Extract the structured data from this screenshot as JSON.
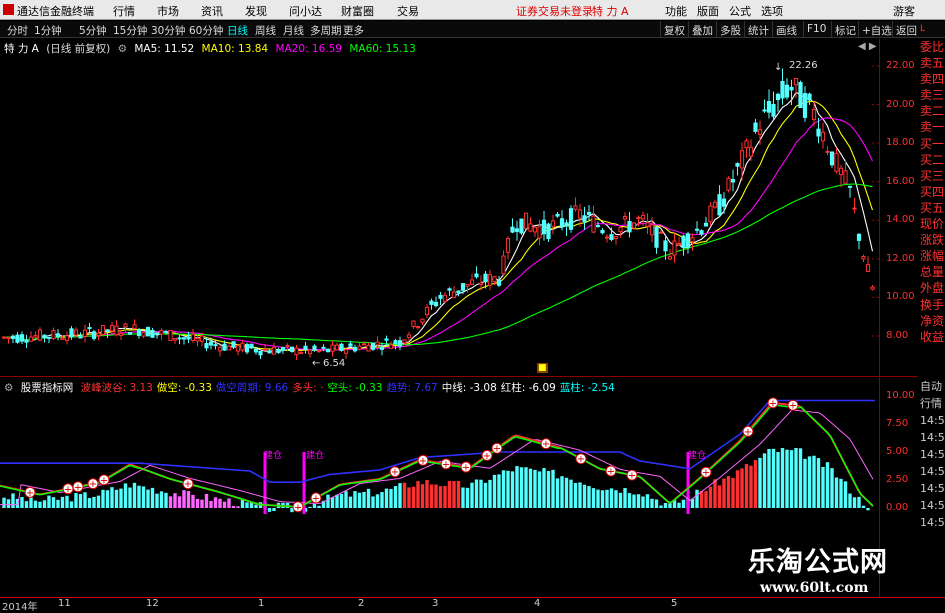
{
  "app": {
    "title": "通达信金融终端"
  },
  "menu": [
    "行情",
    "市场",
    "资讯",
    "发现",
    "问小达",
    "财富圈",
    "交易"
  ],
  "notice": "证券交易未登录",
  "stock_name": "特 力 A",
  "right_menu": [
    "功能",
    "版面",
    "公式",
    "选项",
    "游客"
  ],
  "periods": [
    "分时",
    "1分钟",
    "5分钟",
    "15分钟",
    "30分钟",
    "60分钟",
    "日线",
    "周线",
    "月线",
    "多周期",
    "更多"
  ],
  "selected_period": "日线",
  "right_buttons": [
    "复权",
    "叠加",
    "多股",
    "统计",
    "画线",
    "F10",
    "标记",
    "+自选",
    "返回"
  ],
  "main_legend": {
    "title": "特 力 A",
    "adjust": "(日线 前复权)",
    "ma5": "MA5: 11.52",
    "ma10": "MA10: 13.84",
    "ma20": "MA20: 16.59",
    "ma60": "MA60: 15.13"
  },
  "price_axis": [
    "22.00",
    "20.00",
    "18.00",
    "16.00",
    "14.00",
    "12.00",
    "10.00",
    "8.00"
  ],
  "annotations": {
    "high": "22.26",
    "low": "6.54"
  },
  "indicator_legend": {
    "name": "股票指标网",
    "items": [
      {
        "text": "波峰波谷: 3.13",
        "color": "#ff3030"
      },
      {
        "text": "做空: -0.33",
        "color": "#ffff00"
      },
      {
        "text": "做空周期: 9.66",
        "color": "#3030ff"
      },
      {
        "text": "多头: ·",
        "color": "#ff3030"
      },
      {
        "text": "空头: -0.33",
        "color": "#00ff00"
      },
      {
        "text": "趋势: 7.67",
        "color": "#3030ff"
      },
      {
        "text": "中线: -3.08",
        "color": "#ffffff"
      },
      {
        "text": "红柱: -6.09",
        "color": "#ffffff"
      },
      {
        "text": "蓝柱: -2.54",
        "color": "#00ffff"
      }
    ]
  },
  "indicator_axis": [
    "10.00",
    "7.50",
    "5.00",
    "2.50",
    "0.00"
  ],
  "side_panel": [
    "委比",
    "卖五",
    "卖四",
    "卖三",
    "卖二",
    "卖一",
    "买一",
    "买二",
    "买三",
    "买四",
    "买五",
    "现价",
    "涨跌",
    "涨幅",
    "总量",
    "外盘",
    "换手",
    "净资",
    "收益"
  ],
  "side_panel2": [
    "自动",
    "行情",
    "14:5",
    "14:5",
    "14:5",
    "14:5",
    "14:5",
    "14:5",
    "14:5"
  ],
  "signals": {
    "buy": "建仓"
  },
  "x_axis": [
    "2014年",
    "11",
    "12",
    "1",
    "2",
    "3",
    "4",
    "5"
  ],
  "watermark": {
    "cn": "乐淘公式网",
    "url": "www.60lt.com"
  },
  "colors": {
    "up": "#ff3030",
    "down": "#54ffff",
    "ma5": "#ffffff",
    "ma10": "#ffff00",
    "ma20": "#ff00ff",
    "ma60": "#00ff00"
  }
}
